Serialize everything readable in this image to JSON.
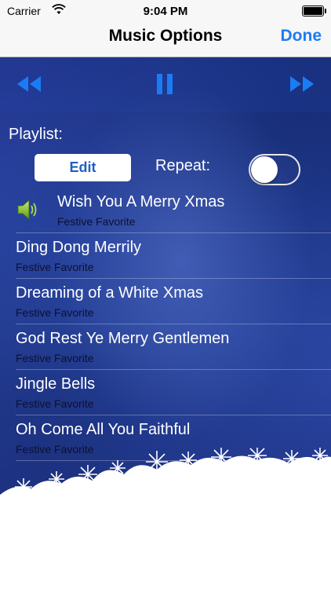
{
  "status_bar": {
    "carrier": "Carrier",
    "time": "9:04 PM"
  },
  "nav": {
    "title": "Music Options",
    "done_label": "Done"
  },
  "controls": {
    "rewind_icon": "rewind-icon",
    "pause_icon": "pause-icon",
    "forward_icon": "fast-forward-icon",
    "accent_color": "#1a7cf5"
  },
  "playlist": {
    "label": "Playlist:",
    "edit_label": "Edit",
    "repeat_label": "Repeat:",
    "repeat_on": false
  },
  "tracks": [
    {
      "title": "Wish You A Merry Xmas",
      "subtitle": "Festive Favorite",
      "playing": true
    },
    {
      "title": "Ding Dong Merrily",
      "subtitle": "Festive Favorite",
      "playing": false
    },
    {
      "title": "Dreaming of a White Xmas",
      "subtitle": "Festive Favorite",
      "playing": false
    },
    {
      "title": "God Rest Ye Merry Gentlemen",
      "subtitle": "Festive Favorite",
      "playing": false
    },
    {
      "title": "Jingle Bells",
      "subtitle": "Festive Favorite",
      "playing": false
    },
    {
      "title": "Oh Come All You Faithful",
      "subtitle": "Festive Favorite",
      "playing": false
    }
  ]
}
